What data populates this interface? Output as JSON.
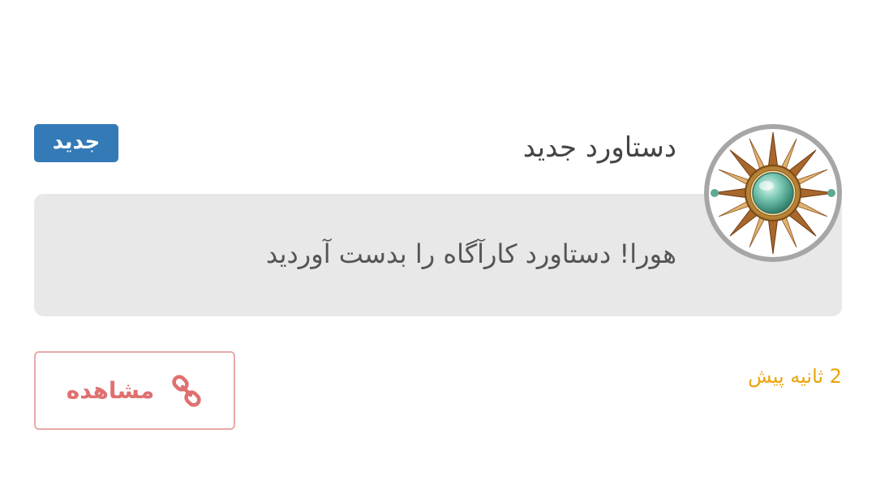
{
  "notification": {
    "badge": "جدید",
    "title": "دستاورد جدید",
    "message": "هورا! دستاورد کارآگاه را بدست آوردید",
    "time": "2 ثانیه پیش",
    "icon": "medal-icon"
  },
  "actions": {
    "view_label": "مشاهده",
    "view_icon": "link-icon"
  },
  "colors": {
    "badge_bg": "#337ab7",
    "time_text": "#eba40c",
    "button_text": "#e07070",
    "button_border": "#e9a9a9",
    "message_bg": "#e8e8e8"
  }
}
